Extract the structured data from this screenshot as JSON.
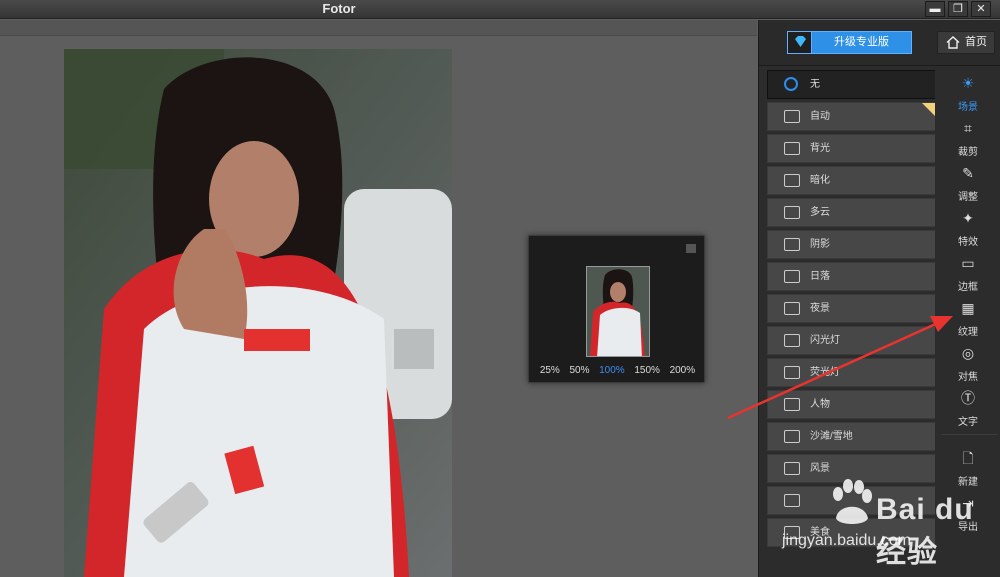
{
  "window": {
    "title": "Fotor",
    "minimize_label": "▬",
    "restore_label": "❐",
    "close_label": "✕"
  },
  "header": {
    "upgrade_label": "升级专业版",
    "home_label": "首页"
  },
  "zoom_popup": {
    "levels": [
      "25%",
      "50%",
      "100%",
      "150%",
      "200%"
    ],
    "active_level": "100%"
  },
  "scenes": {
    "items": [
      {
        "label": "无",
        "icon": "none-icon",
        "active": true
      },
      {
        "label": "自动",
        "icon": "camera-icon"
      },
      {
        "label": "背光",
        "icon": "backlight-icon"
      },
      {
        "label": "暗化",
        "icon": "darken-icon"
      },
      {
        "label": "多云",
        "icon": "cloud-icon"
      },
      {
        "label": "阴影",
        "icon": "shadow-icon"
      },
      {
        "label": "日落",
        "icon": "sunset-icon"
      },
      {
        "label": "夜景",
        "icon": "moon-icon"
      },
      {
        "label": "闪光灯",
        "icon": "flash-icon"
      },
      {
        "label": "荧光灯",
        "icon": "fluorescent-icon"
      },
      {
        "label": "人物",
        "icon": "portrait-icon"
      },
      {
        "label": "沙滩/雪地",
        "icon": "beach-icon"
      },
      {
        "label": "风景",
        "icon": "landscape-icon"
      },
      {
        "label": "",
        "icon": "building-icon"
      },
      {
        "label": "美食",
        "icon": "food-icon"
      }
    ]
  },
  "tools": {
    "items": [
      {
        "label": "场景",
        "icon": "sun-icon",
        "active": true
      },
      {
        "label": "裁剪",
        "icon": "crop-icon"
      },
      {
        "label": "调整",
        "icon": "pencil-icon"
      },
      {
        "label": "特效",
        "icon": "sparkle-icon"
      },
      {
        "label": "边框",
        "icon": "frame-icon"
      },
      {
        "label": "纹理",
        "icon": "checker-icon"
      },
      {
        "label": "对焦",
        "icon": "focus-icon"
      },
      {
        "label": "文字",
        "icon": "text-icon"
      },
      {
        "label": "新建",
        "icon": "new-file-icon"
      },
      {
        "label": "导出",
        "icon": "export-icon"
      }
    ]
  },
  "watermark": {
    "brand": "Bai du 经验",
    "url": "jingyan.baidu.com"
  },
  "colors": {
    "accent": "#2e90e6",
    "active_text": "#3d9af7",
    "arrow": "#e8332e"
  }
}
